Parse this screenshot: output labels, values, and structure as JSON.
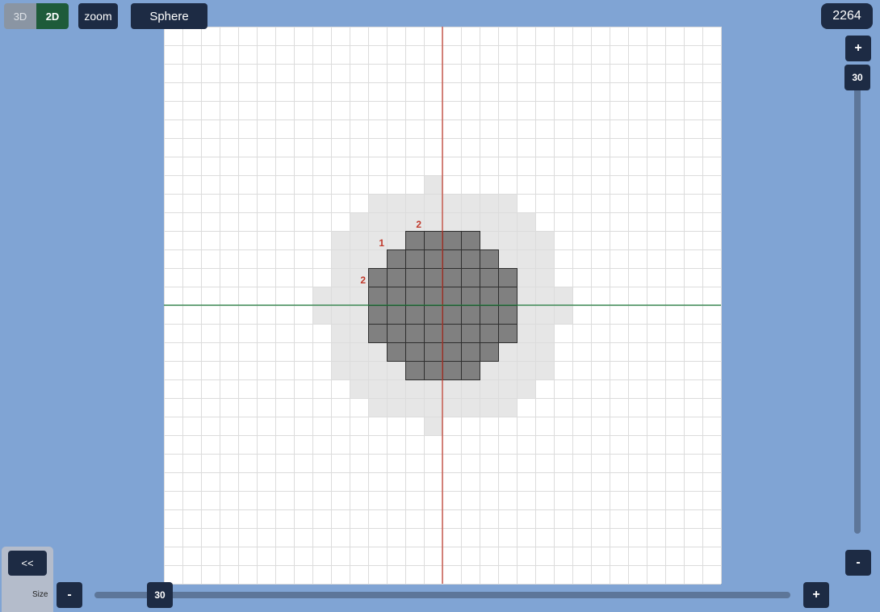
{
  "toolbar": {
    "mode_3d": "3D",
    "mode_2d": "2D",
    "active_mode": "2D",
    "zoom_label": "zoom",
    "shape_label": "Sphere",
    "block_count": "2264"
  },
  "vertical_slider": {
    "plus": "+",
    "minus": "-",
    "value": "30"
  },
  "horizontal_slider": {
    "label": "Size",
    "plus": "+",
    "minus": "-",
    "value": "30"
  },
  "panel": {
    "collapse_label": "<<"
  },
  "grid": {
    "cols": 30,
    "rows": 30,
    "filled_color": "#808080",
    "outer_color": "#e6e6e6",
    "grid_line_color": "#dcdcdc",
    "vertical_axis_color": "#c0392b",
    "horizontal_axis_color": "#1e7a3a",
    "dark_rows": [
      {
        "row": 11,
        "c0": 13,
        "c1": 16
      },
      {
        "row": 12,
        "c0": 12,
        "c1": 17
      },
      {
        "row": 13,
        "c0": 11,
        "c1": 18
      },
      {
        "row": 14,
        "c0": 11,
        "c1": 18
      },
      {
        "row": 15,
        "c0": 11,
        "c1": 18
      },
      {
        "row": 16,
        "c0": 11,
        "c1": 18
      },
      {
        "row": 17,
        "c0": 12,
        "c1": 17
      },
      {
        "row": 18,
        "c0": 13,
        "c1": 16
      }
    ],
    "light_rows": [
      {
        "row": 8,
        "c0": 14,
        "c1": 14
      },
      {
        "row": 9,
        "c0": 11,
        "c1": 18
      },
      {
        "row": 10,
        "c0": 10,
        "c1": 19
      },
      {
        "row": 11,
        "c0": 9,
        "c1": 20
      },
      {
        "row": 12,
        "c0": 9,
        "c1": 20
      },
      {
        "row": 13,
        "c0": 9,
        "c1": 20
      },
      {
        "row": 14,
        "c0": 8,
        "c1": 21
      },
      {
        "row": 15,
        "c0": 8,
        "c1": 21
      },
      {
        "row": 16,
        "c0": 9,
        "c1": 20
      },
      {
        "row": 17,
        "c0": 9,
        "c1": 20
      },
      {
        "row": 18,
        "c0": 9,
        "c1": 20
      },
      {
        "row": 19,
        "c0": 10,
        "c1": 19
      },
      {
        "row": 20,
        "c0": 11,
        "c1": 18
      },
      {
        "row": 21,
        "c0": 14,
        "c1": 14
      }
    ],
    "annotations": [
      {
        "text": "2",
        "row": 10,
        "col": 13
      },
      {
        "text": "1",
        "row": 11,
        "col": 11
      },
      {
        "text": "2",
        "row": 13,
        "col": 10
      }
    ]
  }
}
